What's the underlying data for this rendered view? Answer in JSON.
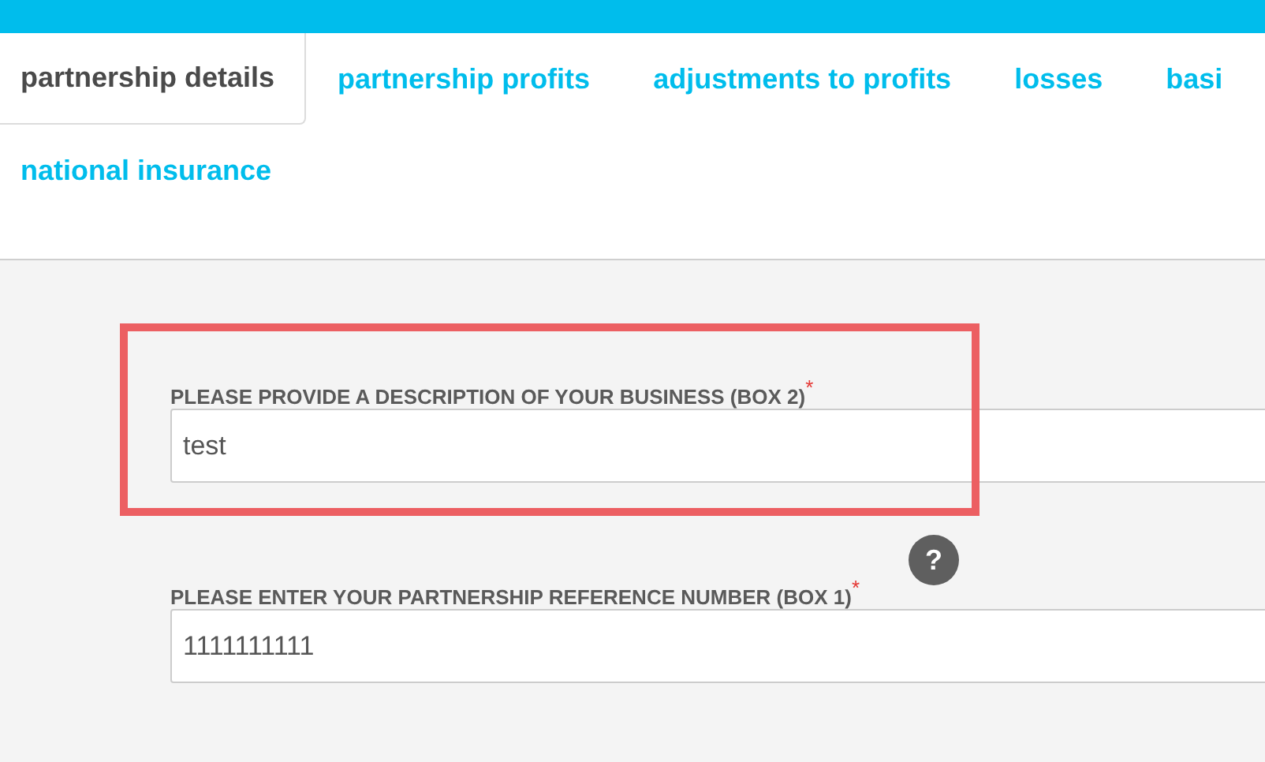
{
  "tabs": [
    {
      "label": "partnership details",
      "selected": true
    },
    {
      "label": "partnership profits",
      "selected": false
    },
    {
      "label": "adjustments to profits",
      "selected": false
    },
    {
      "label": "losses",
      "selected": false
    },
    {
      "label": "basi",
      "selected": false
    },
    {
      "label": "national insurance",
      "selected": false
    }
  ],
  "fields": [
    {
      "label": "PLEASE PROVIDE A DESCRIPTION OF YOUR BUSINESS (BOX 2)",
      "required_mark": "*",
      "value": "test",
      "highlighted": true
    },
    {
      "label": "PLEASE ENTER YOUR PARTNERSHIP REFERENCE NUMBER (BOX 1)",
      "required_mark": "*",
      "help": "?",
      "value": "1111111111",
      "highlighted": false
    }
  ]
}
